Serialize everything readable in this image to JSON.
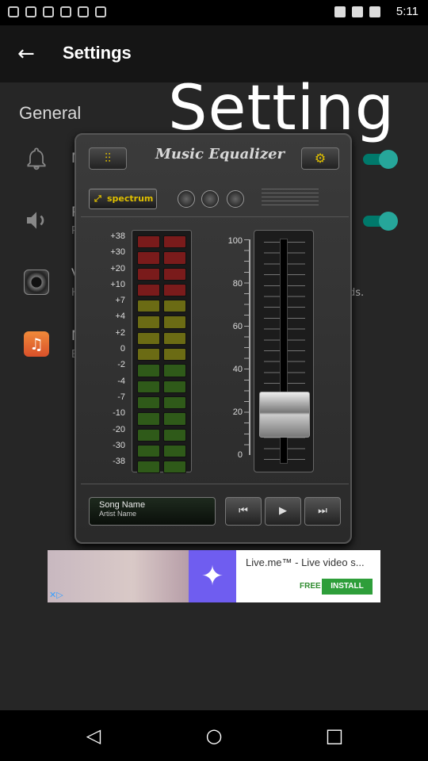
{
  "status_bar": {
    "time": "5:11"
  },
  "app_bar": {
    "back_icon": "arrow-back-icon",
    "title": "Settings"
  },
  "settings": {
    "section_title": "General",
    "rows": [
      {
        "icon": "bell-icon",
        "title_partial": "N",
        "subtitle_partial": ""
      },
      {
        "icon": "speaker-icon",
        "title_partial": "P",
        "subtitle_partial": "P"
      },
      {
        "icon": "volume-knob-icon",
        "title_partial": "V",
        "subtitle_partial": "H",
        "subtitle_tail": "ds."
      },
      {
        "icon": "music-note-icon",
        "title_partial": "N",
        "subtitle_partial": "E"
      }
    ],
    "toggles": [
      true,
      true
    ]
  },
  "overlay_text": "Setting",
  "equalizer": {
    "title": "Music Equalizer",
    "spectrum_label": "spectrum",
    "meter_labels": [
      "+38",
      "+30",
      "+20",
      "+10",
      "+7",
      "+4",
      "+2",
      "0",
      "-2",
      "-4",
      "-7",
      "-10",
      "-20",
      "-30",
      "-38"
    ],
    "scale_labels": [
      "100",
      "80",
      "60",
      "40",
      "20",
      "0"
    ],
    "fader_level_percent": 20,
    "song_name": "Song Name",
    "artist_name": "Artist Name",
    "controls": [
      "previous",
      "play",
      "next"
    ],
    "colors": {
      "red": "#7a1b1b",
      "yellow": "#6b6b14",
      "green": "#2f5a19"
    }
  },
  "ad": {
    "title": "Live.me™ - Live video s...",
    "free_label": "FREE",
    "install_label": "INSTALL"
  },
  "nav": {
    "back": "back-icon",
    "home": "home-icon",
    "recents": "recents-icon"
  }
}
